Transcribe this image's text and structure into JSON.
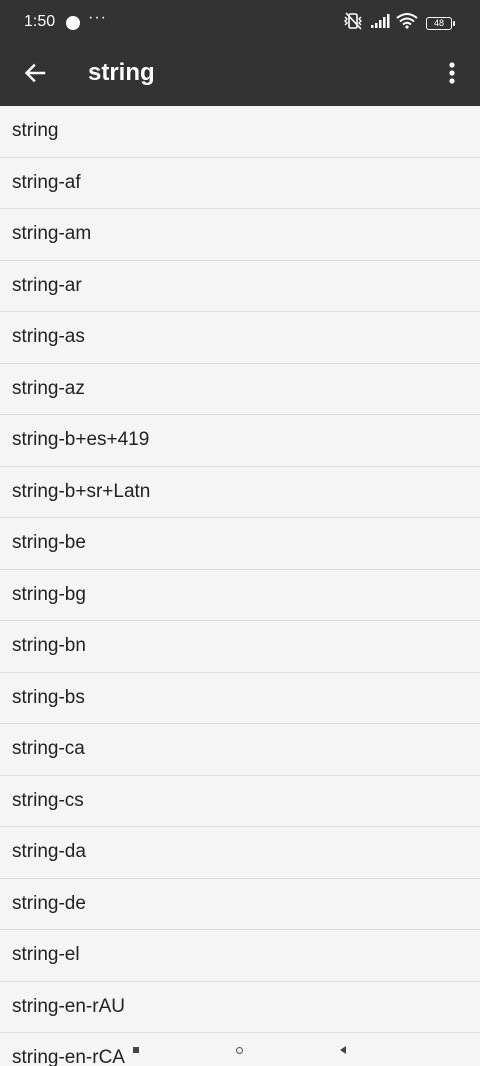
{
  "status_bar": {
    "time": "1:50",
    "more": "···",
    "battery": "48"
  },
  "app_bar": {
    "title": "string"
  },
  "colors": {
    "app_bar_background": "#333333",
    "list_background": "#f5f5f5",
    "divider": "#dddddd"
  },
  "items": [
    "string",
    "string-af",
    "string-am",
    "string-ar",
    "string-as",
    "string-az",
    "string-b+es+419",
    "string-b+sr+Latn",
    "string-be",
    "string-bg",
    "string-bn",
    "string-bs",
    "string-ca",
    "string-cs",
    "string-da",
    "string-de",
    "string-el",
    "string-en-rAU",
    "string-en-rCA"
  ]
}
